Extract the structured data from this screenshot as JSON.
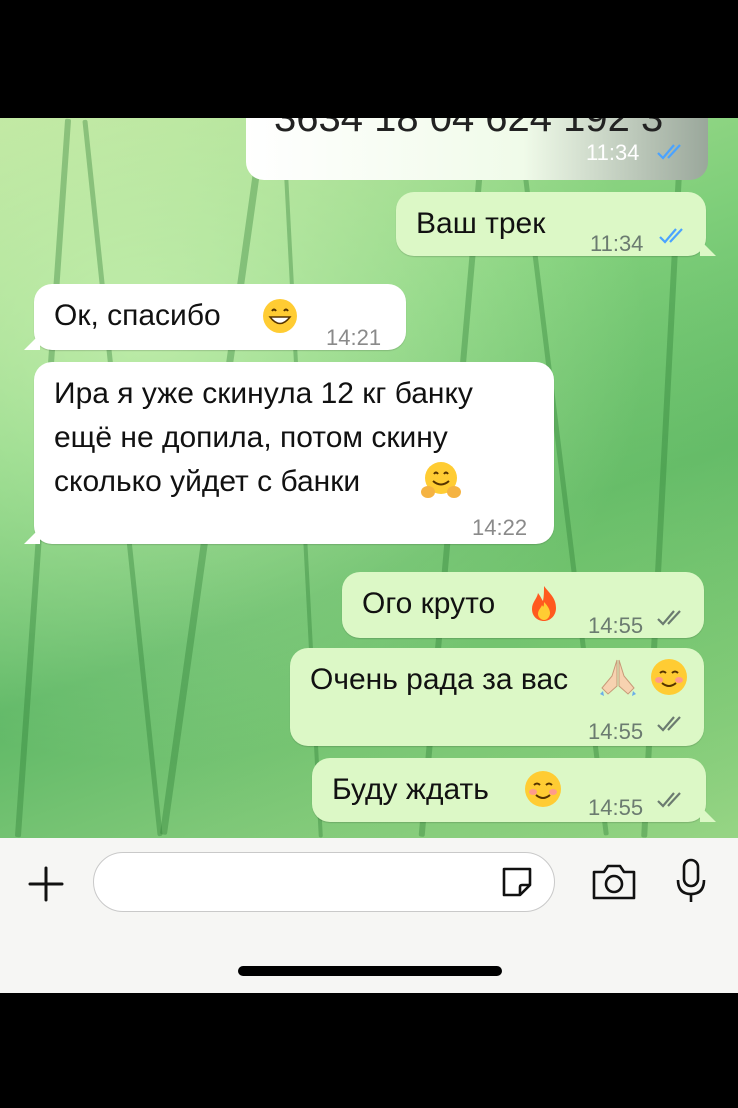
{
  "top_message": {
    "partial_text": "3634 18 04 624 192 3",
    "time": "11:34",
    "read": true
  },
  "messages": [
    {
      "side": "out",
      "text": "Ваш трек",
      "time": "11:34",
      "status": "read"
    },
    {
      "side": "in",
      "text": "Ок, спасибо",
      "emoji": "grinning-face",
      "time": "14:21"
    },
    {
      "side": "in",
      "line1": "Ира я уже скинула 12 кг банку",
      "line2": "ещё не допила, потом скину",
      "line3": "сколько уйдет с банки",
      "emoji": "hugging-face",
      "time": "14:22"
    },
    {
      "side": "out",
      "text": "Ого круто",
      "emoji": "fire",
      "time": "14:55",
      "status": "delivered"
    },
    {
      "side": "out",
      "text": "Очень рада за вас",
      "emoji": "praying-hands smiling-face",
      "time": "14:55",
      "status": "delivered"
    },
    {
      "side": "out",
      "text": "Буду ждать",
      "emoji": "smiling-face",
      "time": "14:55",
      "status": "delivered"
    }
  ],
  "input": {
    "placeholder": ""
  },
  "colors": {
    "outgoing": "#dcf8c6",
    "incoming": "#ffffff",
    "read_ticks": "#4aa3ff",
    "delivered_ticks": "#6b7b70"
  }
}
